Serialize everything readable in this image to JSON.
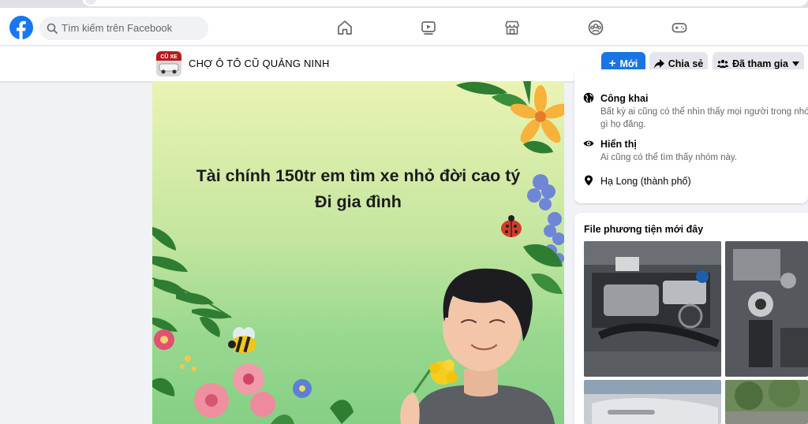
{
  "search": {
    "placeholder": "Tìm kiếm trên Facebook"
  },
  "group": {
    "name": "CHỢ Ô TÔ CŨ QUẢNG NINH",
    "thumb_label": "CŨ XE"
  },
  "buttons": {
    "new_label": "Mới",
    "share_label": "Chia sẻ",
    "joined_label": "Đã tham gia"
  },
  "post": {
    "line1": "Tài chính 150tr em tìm xe nhỏ đời cao tý",
    "line2": "Đi gia đình"
  },
  "about": {
    "public_title": "Công khai",
    "public_desc_1": "Bất kỳ ai cũng có thể nhìn thấy mọi người trong nhó",
    "public_desc_2": "gì họ đăng.",
    "visible_title": "Hiển thị",
    "visible_desc": "Ai cũng có thể tìm thấy nhóm này.",
    "location": "Hạ Long (thành phố)"
  },
  "media": {
    "title": "File phương tiện mới đây"
  },
  "colors": {
    "facebook_blue": "#1877f2",
    "button_blue": "#1b74e4",
    "secondary_bg": "#e4e6eb",
    "page_bg": "#f0f2f5"
  },
  "icons": {
    "nav": [
      "home-icon",
      "watch-icon",
      "marketplace-icon",
      "groups-icon",
      "gaming-icon"
    ]
  }
}
